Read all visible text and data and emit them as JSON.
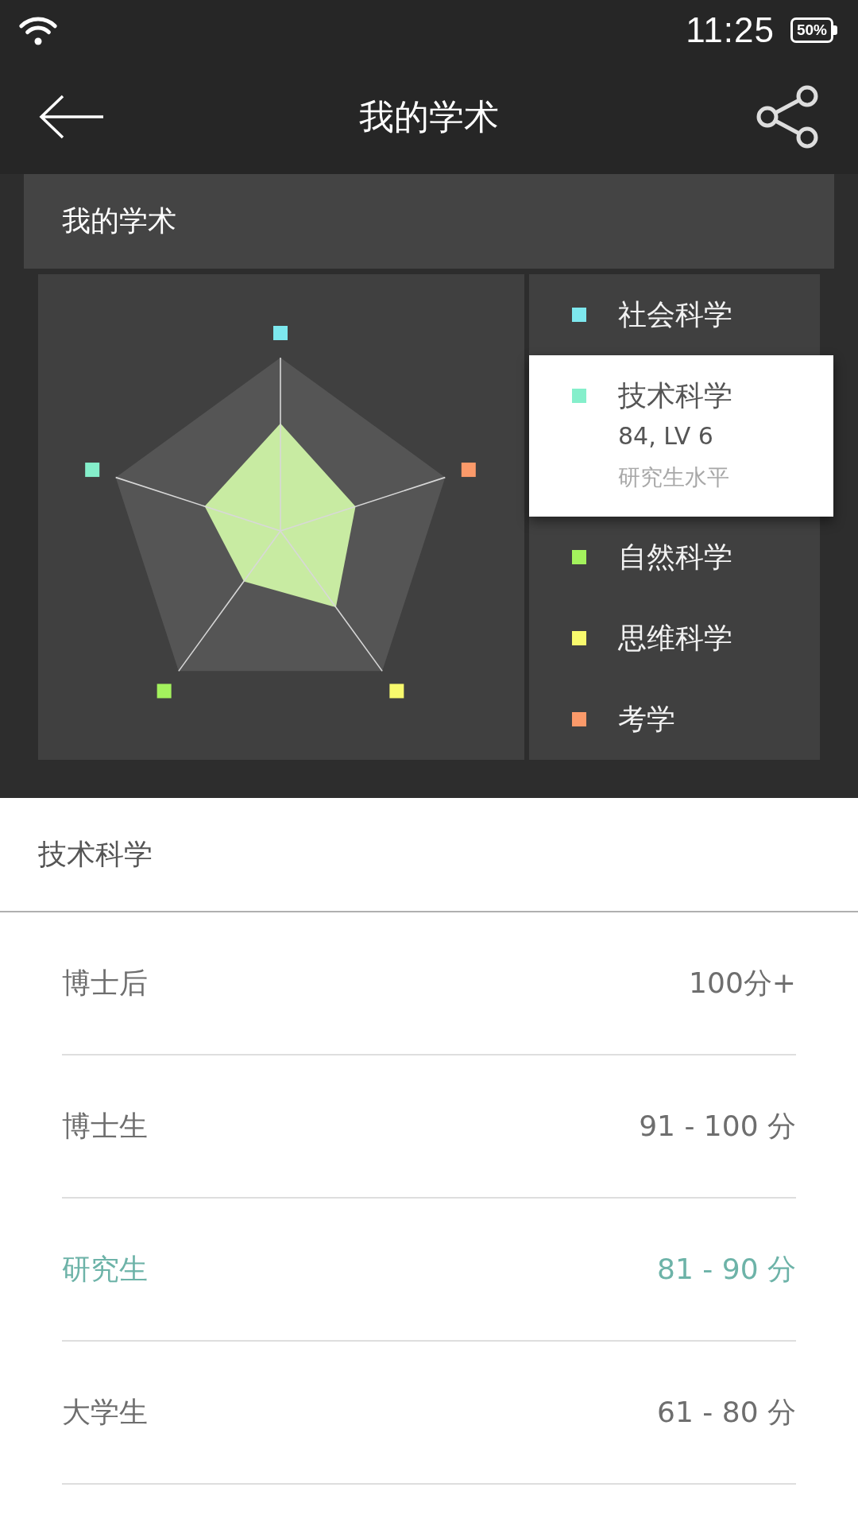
{
  "status_bar": {
    "time": "11:25",
    "battery": "50%"
  },
  "app_bar": {
    "title": "我的学术"
  },
  "card": {
    "title": "我的学术"
  },
  "legend": {
    "items": [
      {
        "label": "社会科学",
        "color": "#7de8ee",
        "selected": false
      },
      {
        "label": "技术科学",
        "color": "#85efcb",
        "selected": true,
        "score": "84, LV 6",
        "level_label": "研究生水平"
      },
      {
        "label": "自然科学",
        "color": "#a3f25d",
        "selected": false
      },
      {
        "label": "思维科学",
        "color": "#f8fa6d",
        "selected": false
      },
      {
        "label": "考学",
        "color": "#fb9a6a",
        "selected": false
      }
    ]
  },
  "detail": {
    "title": "技术科学",
    "rows": [
      {
        "name": "博士后",
        "range": "100分+",
        "selected": false
      },
      {
        "name": "博士生",
        "range": "91 - 100 分",
        "selected": false
      },
      {
        "name": "研究生",
        "range": "81 - 90 分",
        "selected": true
      },
      {
        "name": "大学生",
        "range": "61 - 80 分",
        "selected": false
      }
    ]
  }
}
